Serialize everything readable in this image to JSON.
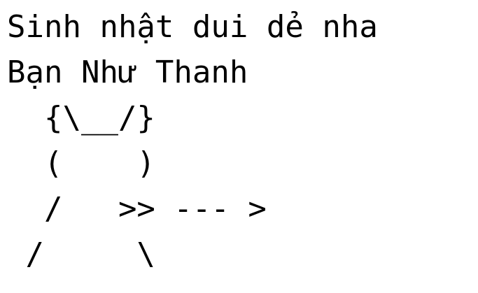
{
  "text_lines": [
    "Sinh nhật dui dẻ nha",
    "Bạn Như Thanh",
    "  {\\__/}",
    "  (    )",
    "  /   >> --- >",
    " /     \\"
  ],
  "colors": {
    "background": "#ffffff",
    "text": "#000000"
  }
}
